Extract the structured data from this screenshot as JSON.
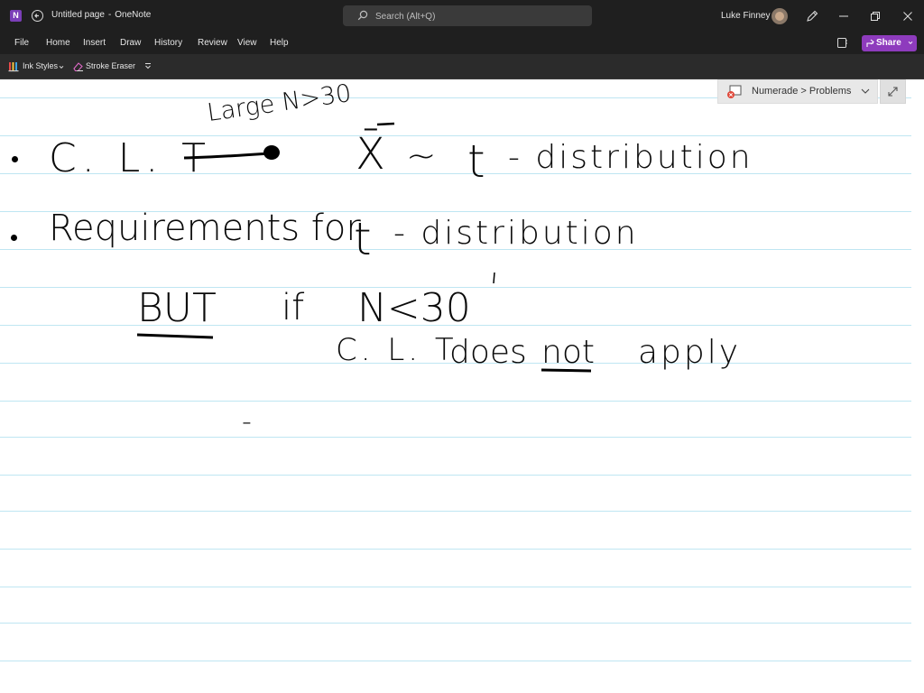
{
  "titlebar": {
    "logo_letter": "N",
    "page_title": "Untitled page",
    "separator": "-",
    "app_name": "OneNote",
    "search_placeholder": "Search (Alt+Q)",
    "user_name": "Luke Finney"
  },
  "menu": {
    "items": [
      "File",
      "Home",
      "Insert",
      "Draw",
      "History",
      "Review",
      "View",
      "Help"
    ],
    "share_label": "Share"
  },
  "toolbar": {
    "ink_styles_label": "Ink Styles",
    "stroke_eraser_label": "Stroke Eraser"
  },
  "page": {
    "notebook_link": "Numerade > Problems",
    "ink": {
      "line1_left": "C. L. T",
      "line1_above": "Large N>30",
      "line1_right_x": "X̄",
      "line1_tilde": "~",
      "line1_t": "t",
      "line1_dist": "- distribution",
      "line2_req": "Requirements  for",
      "line2_t": "t",
      "line2_dist": "- distribution",
      "line3_but": "BUT",
      "line3_if": "if",
      "line3_n": "N<30",
      "line4_clt": "C. L. T",
      "line4_does": "does",
      "line4_not": "not",
      "line4_apply": "apply",
      "stray_mark": "-"
    }
  },
  "colors": {
    "chrome_bg": "#1f1f1f",
    "toolbar_bg": "#2b2b2b",
    "share_accent": "#8e3bbd",
    "rule_line": "#bfe6f2",
    "ink": "#000000"
  }
}
